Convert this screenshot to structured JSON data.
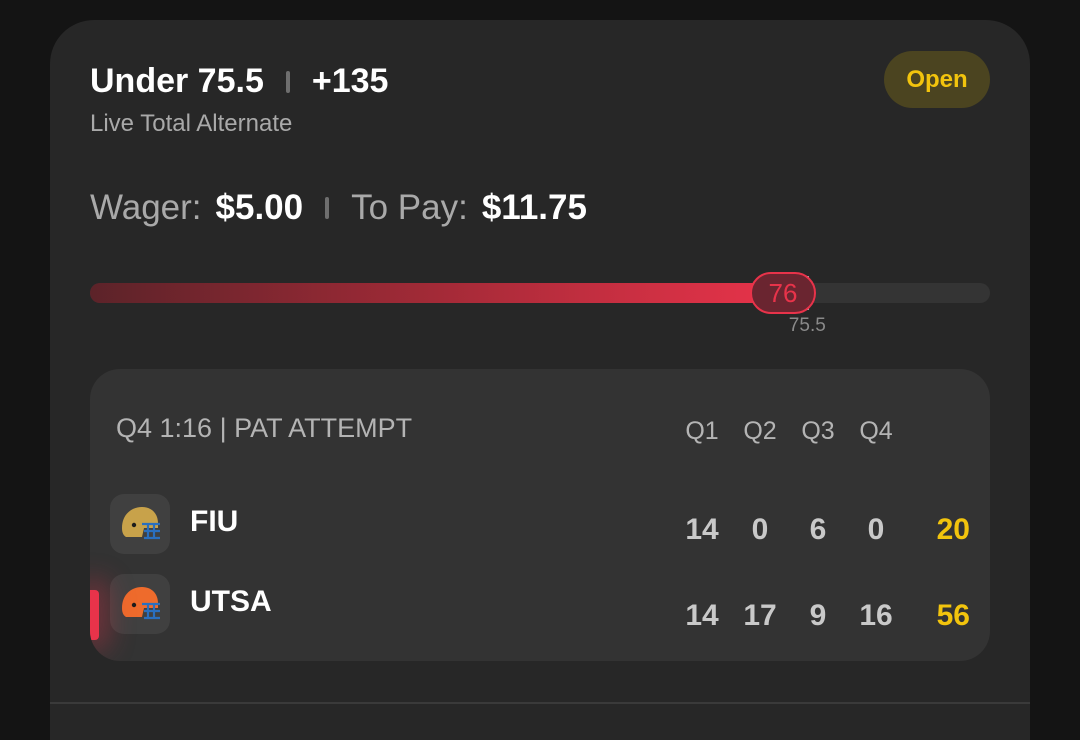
{
  "bet": {
    "selection": "Under 75.5",
    "odds": "+135",
    "market": "Live Total Alternate",
    "status": "Open",
    "wager_label": "Wager:",
    "wager_value": "$5.00",
    "topay_label": "To Pay:",
    "topay_value": "$11.75"
  },
  "progress": {
    "current": "76",
    "line": "75.5",
    "current_fraction": 0.77,
    "line_fraction": 0.797
  },
  "scoreboard": {
    "game_status": "Q4 1:16 | PAT ATTEMPT",
    "quarters": [
      "Q1",
      "Q2",
      "Q3",
      "Q4"
    ],
    "teams": [
      {
        "name": "FIU",
        "scores": [
          "14",
          "0",
          "6",
          "0"
        ],
        "total": "20",
        "helmet_color": "#c8a24a",
        "has_possession": false
      },
      {
        "name": "UTSA",
        "scores": [
          "14",
          "17",
          "9",
          "16"
        ],
        "total": "56",
        "helmet_color": "#ee6b2c",
        "has_possession": true
      }
    ]
  },
  "colors": {
    "accent_red": "#e8334a",
    "accent_gold": "#f2c40d"
  },
  "icons": {
    "helmet": "football-helmet-icon"
  }
}
